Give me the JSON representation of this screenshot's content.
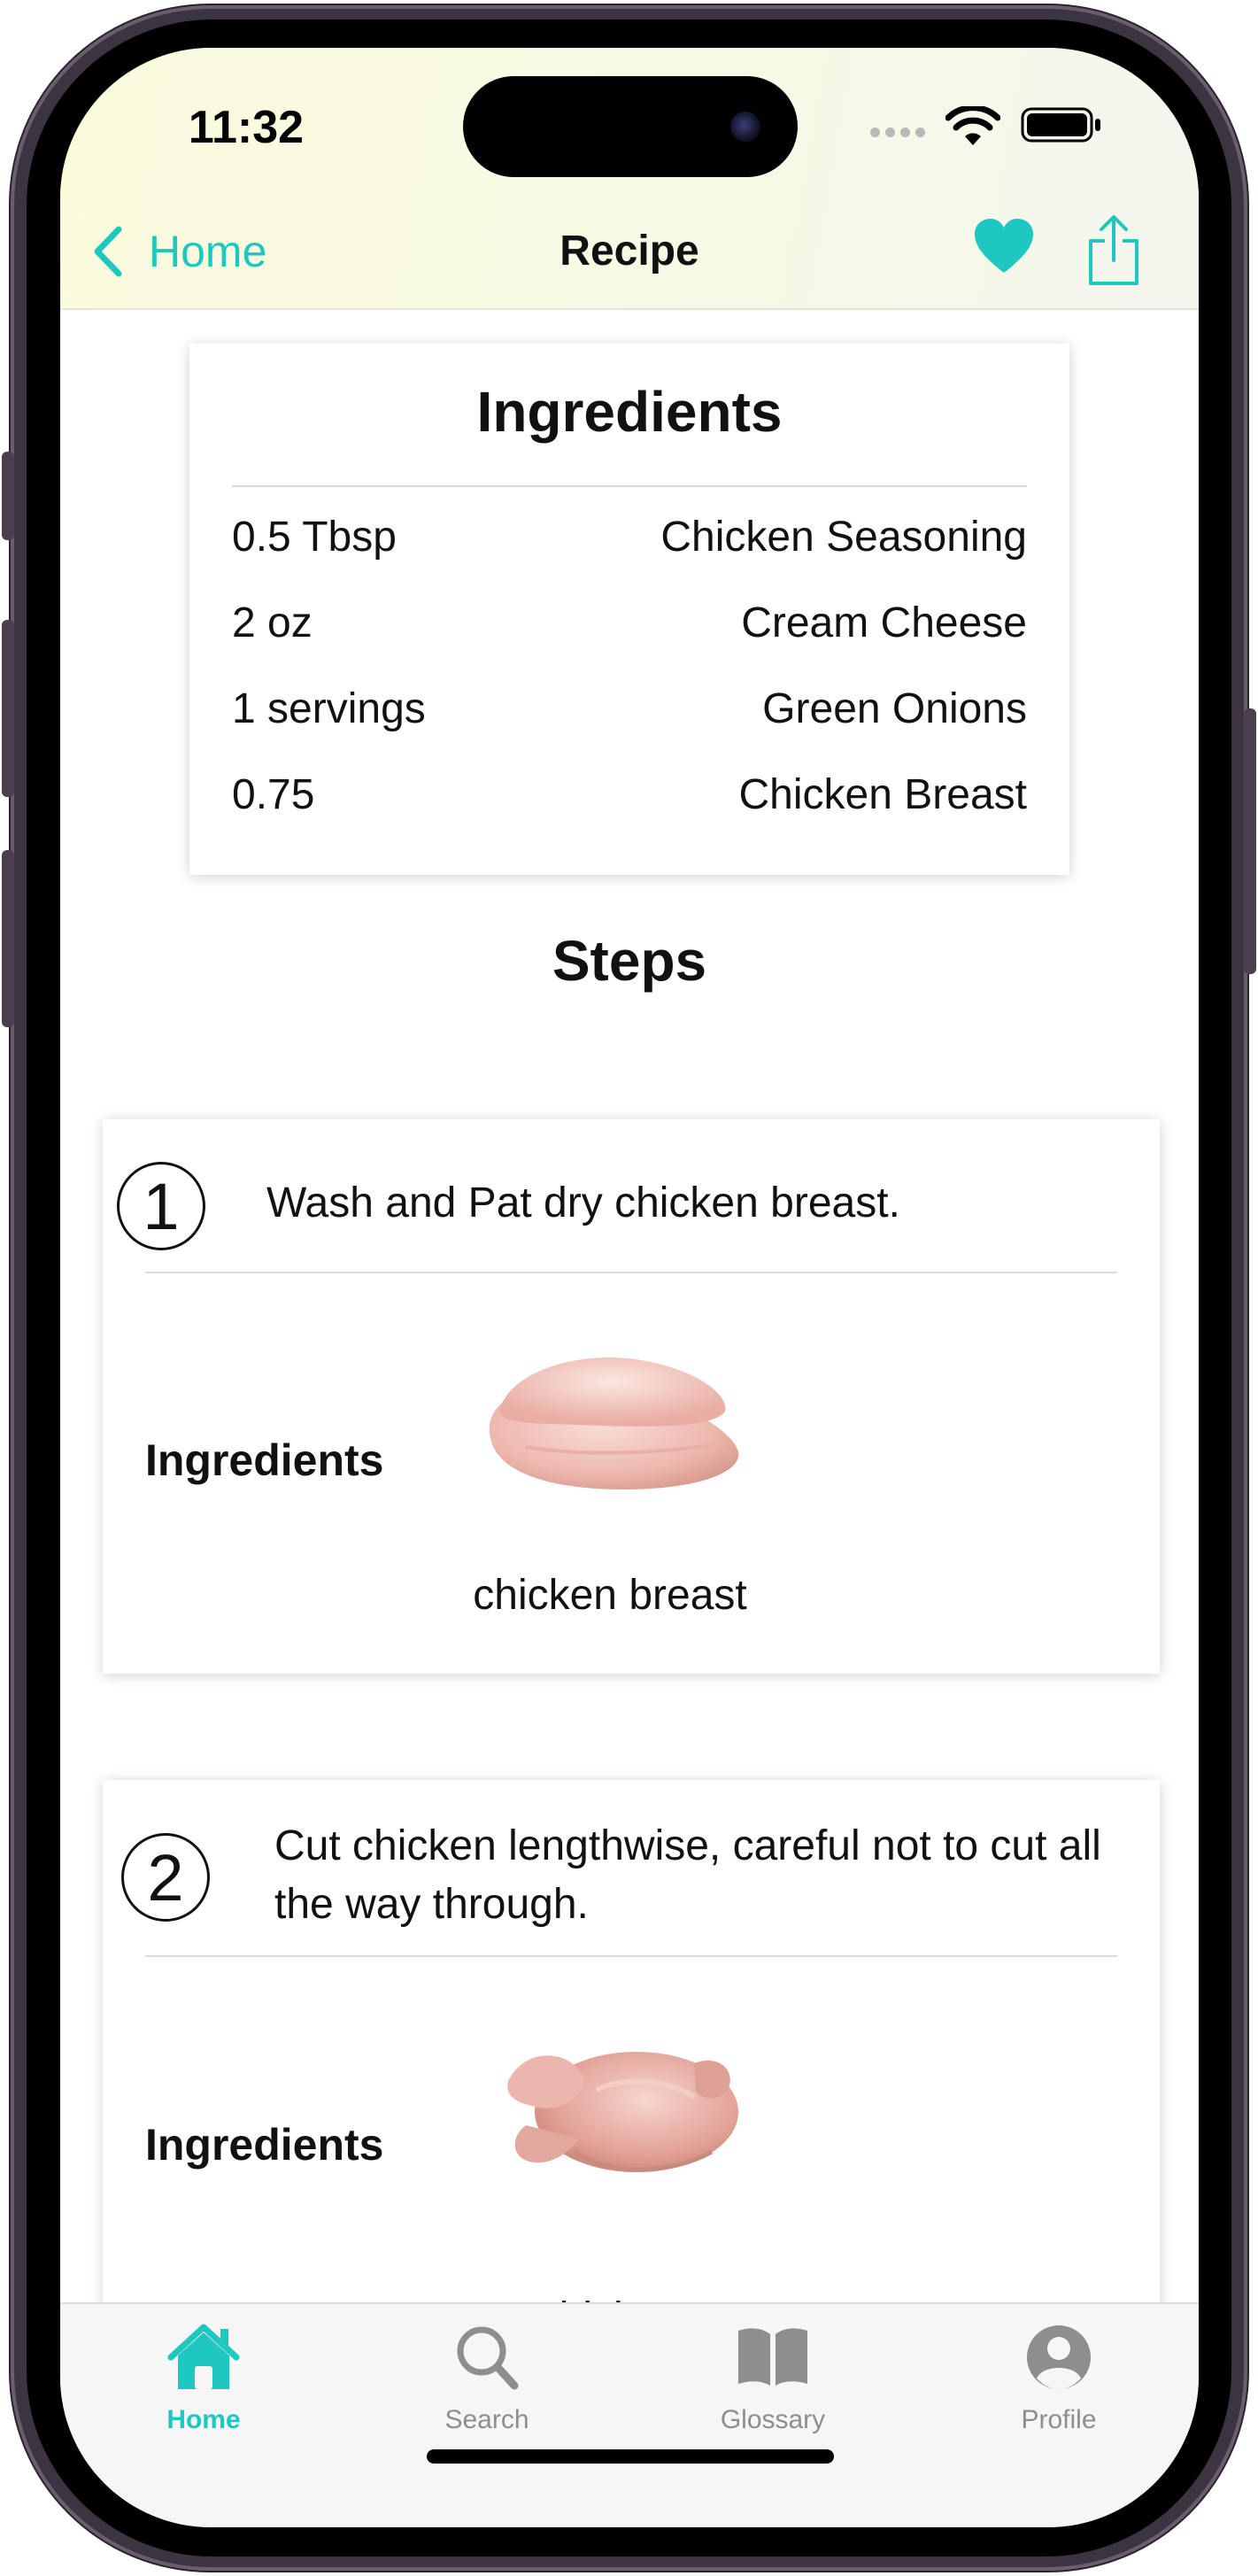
{
  "status": {
    "time": "11:32"
  },
  "nav": {
    "back_label": "Home",
    "title": "Recipe"
  },
  "ingredients": {
    "title": "Ingredients",
    "items": [
      {
        "qty": "0.5 Tbsp",
        "name": "Chicken Seasoning"
      },
      {
        "qty": "2 oz",
        "name": "Cream Cheese"
      },
      {
        "qty": "1 servings",
        "name": "Green Onions"
      },
      {
        "qty": "0.75",
        "name": "Chicken Breast"
      }
    ]
  },
  "steps_heading": "Steps",
  "steps": [
    {
      "number": "1",
      "text": "Wash and Pat dry chicken breast.",
      "ingredients_label": "Ingredients",
      "ingredient_name": "chicken breast",
      "ingredient_icon": "chicken-breast-image"
    },
    {
      "number": "2",
      "text": "Cut chicken lengthwise, careful not to cut all the way through.",
      "ingredients_label": "Ingredients",
      "ingredient_name": "chicken",
      "ingredient_icon": "whole-chicken-image"
    }
  ],
  "tabbar": {
    "items": [
      {
        "label": "Home",
        "icon": "house-icon",
        "active": true
      },
      {
        "label": "Search",
        "icon": "magnifier-icon",
        "active": false
      },
      {
        "label": "Glossary",
        "icon": "book-icon",
        "active": false
      },
      {
        "label": "Profile",
        "icon": "person-circle-icon",
        "active": false
      }
    ]
  },
  "colors": {
    "accent": "#1fc7c1",
    "header_bg": "#fbfbdc",
    "tab_inactive": "#8e8e8e"
  }
}
